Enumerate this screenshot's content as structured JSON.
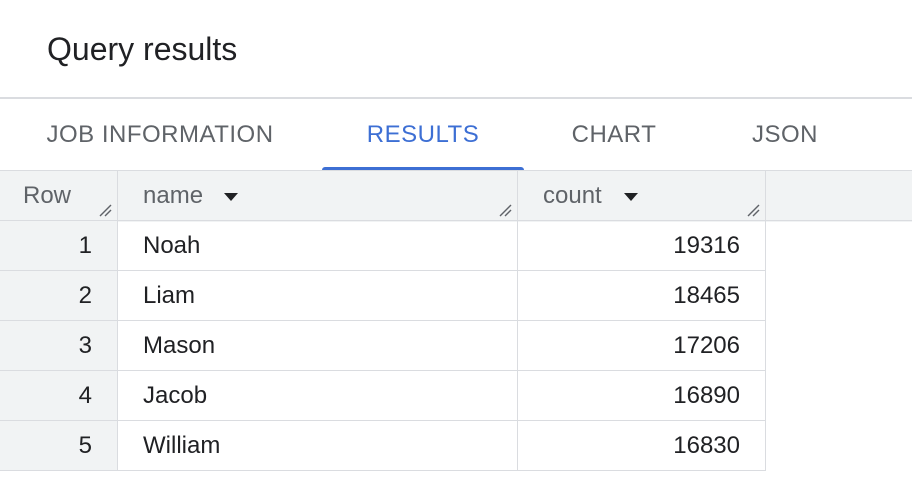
{
  "panel": {
    "title": "Query results"
  },
  "tabs": [
    {
      "label": "JOB INFORMATION",
      "active": false
    },
    {
      "label": "RESULTS",
      "active": true
    },
    {
      "label": "CHART",
      "active": false
    },
    {
      "label": "JSON",
      "active": false
    }
  ],
  "table": {
    "row_header": "Row",
    "columns": [
      {
        "label": "name",
        "sort_icon": "arrow-drop-down-icon",
        "resize_icon": "column-resize-icon"
      },
      {
        "label": "count",
        "sort_icon": "arrow-drop-down-icon",
        "resize_icon": "column-resize-icon"
      }
    ],
    "rows": [
      {
        "row": "1",
        "name": "Noah",
        "count": "19316"
      },
      {
        "row": "2",
        "name": "Liam",
        "count": "18465"
      },
      {
        "row": "3",
        "name": "Mason",
        "count": "17206"
      },
      {
        "row": "4",
        "name": "Jacob",
        "count": "16890"
      },
      {
        "row": "5",
        "name": "William",
        "count": "16830"
      }
    ]
  },
  "colors": {
    "accent": "#3d6fd4",
    "header_bg": "#f1f3f4",
    "border": "#dadce0",
    "text_primary": "#202124",
    "text_secondary": "#5f6368"
  }
}
